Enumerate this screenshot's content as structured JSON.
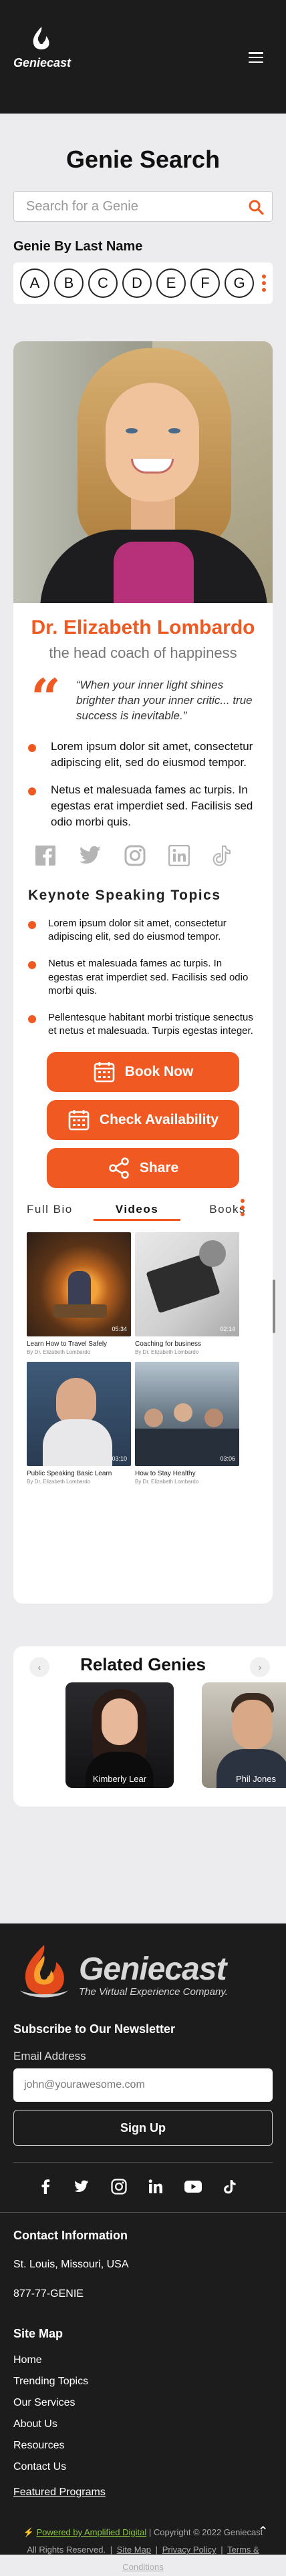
{
  "header": {
    "logo_text": "Geniecast"
  },
  "search": {
    "title": "Genie Search",
    "placeholder": "Search for a Genie"
  },
  "alphabet": {
    "label": "Genie By Last Name",
    "letters": [
      "A",
      "B",
      "C",
      "D",
      "E",
      "F",
      "G"
    ]
  },
  "profile": {
    "name": "Dr. Elizabeth Lombardo",
    "tagline": "the head coach of happiness",
    "quote": "“When your inner light shines brighter than your inner critic... true success is inevitable.”",
    "bullets": [
      "Lorem ipsum dolor sit amet, consectetur adipiscing elit, sed do eiusmod tempor.",
      "Netus et malesuada fames ac turpis. In egestas erat imperdiet sed. Facilisis sed odio morbi quis."
    ],
    "social_icons": [
      "facebook-icon",
      "twitter-icon",
      "instagram-icon",
      "linkedin-icon",
      "tiktok-icon"
    ],
    "topics_title": "Keynote Speaking Topics",
    "topics": [
      "Lorem ipsum dolor sit amet, consectetur adipiscing elit, sed do eiusmod tempor.",
      "Netus et malesuada fames ac turpis. In egestas erat imperdiet sed. Facilisis sed odio morbi quis.",
      "Pellentesque habitant morbi tristique senectus et netus et malesuada. Turpis egestas integer."
    ],
    "actions": {
      "book": "Book Now",
      "availability": "Check Availability",
      "share": "Share"
    },
    "tabs": [
      "Full Bio",
      "Videos",
      "Books"
    ],
    "videos": [
      {
        "title": "Learn How to Travel Safely",
        "by": "By Dr. Elizabeth Lombardo",
        "duration": "05:34"
      },
      {
        "title": "Coaching for business",
        "by": "By Dr. Elizabeth Lombardo",
        "duration": "02:14"
      },
      {
        "title": "Public Speaking Basic Learn",
        "by": "By Dr. Elizabeth Lombardo",
        "duration": "03:10"
      },
      {
        "title": "How to Stay Healthy",
        "by": "By Dr. Elizabeth Lombardo",
        "duration": "03:06"
      }
    ]
  },
  "related": {
    "title": "Related Genies",
    "genies": [
      "Kimberly Lear",
      "Phil Jones"
    ]
  },
  "footer": {
    "logo_text": "Geniecast",
    "logo_sub": "The Virtual Experience Company.",
    "newsletter_title": "Subscribe to Our Newsletter",
    "email_label": "Email Address",
    "email_placeholder": "john@yourawesome.com",
    "signup": "Sign Up",
    "contact_title": "Contact Information",
    "location": "St. Louis, Missouri, USA",
    "phone": "877-77-GENIE",
    "sitemap_title": "Site Map",
    "sitemap": [
      "Home",
      "Trending Topics",
      "Our Services",
      "About Us",
      "Resources",
      "Contact Us"
    ],
    "programs": "Featured Programs",
    "powered": "Powered by Amplified Digital",
    "copyright": "| Copyright © 2022 Geniecast",
    "rights": "All Rights Reserved.",
    "site_map_link": "Site Map",
    "privacy": "Privacy Policy",
    "terms": "Terms & Conditions"
  },
  "colors": {
    "accent": "#f05a22",
    "dark": "#1c1c1c",
    "page": "#ececee"
  }
}
